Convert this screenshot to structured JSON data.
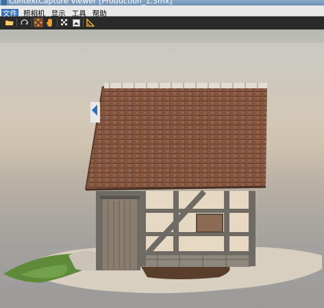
{
  "window": {
    "title": "ContextCapture Viewer [Production_1.3mx]"
  },
  "menu": {
    "items": [
      "文件",
      "照相机",
      "显示",
      "工具",
      "帮助"
    ],
    "active_index": 0
  },
  "toolbar": {
    "tools": [
      {
        "icon": "folder-open-icon"
      },
      {
        "icon": "rotate-icon"
      },
      {
        "icon": "pan-icon",
        "active": true
      },
      {
        "icon": "hand-icon"
      },
      {
        "icon": "checkerboard-icon"
      },
      {
        "icon": "snapshot-icon"
      },
      {
        "icon": "measure-ruler-icon"
      }
    ]
  },
  "colors": {
    "accent": "#3d6fb5",
    "active_tool": "#7a4a2a",
    "roof": "#8a5a45",
    "plaster": "#e7d8c4",
    "timber": "#6f6a63"
  }
}
